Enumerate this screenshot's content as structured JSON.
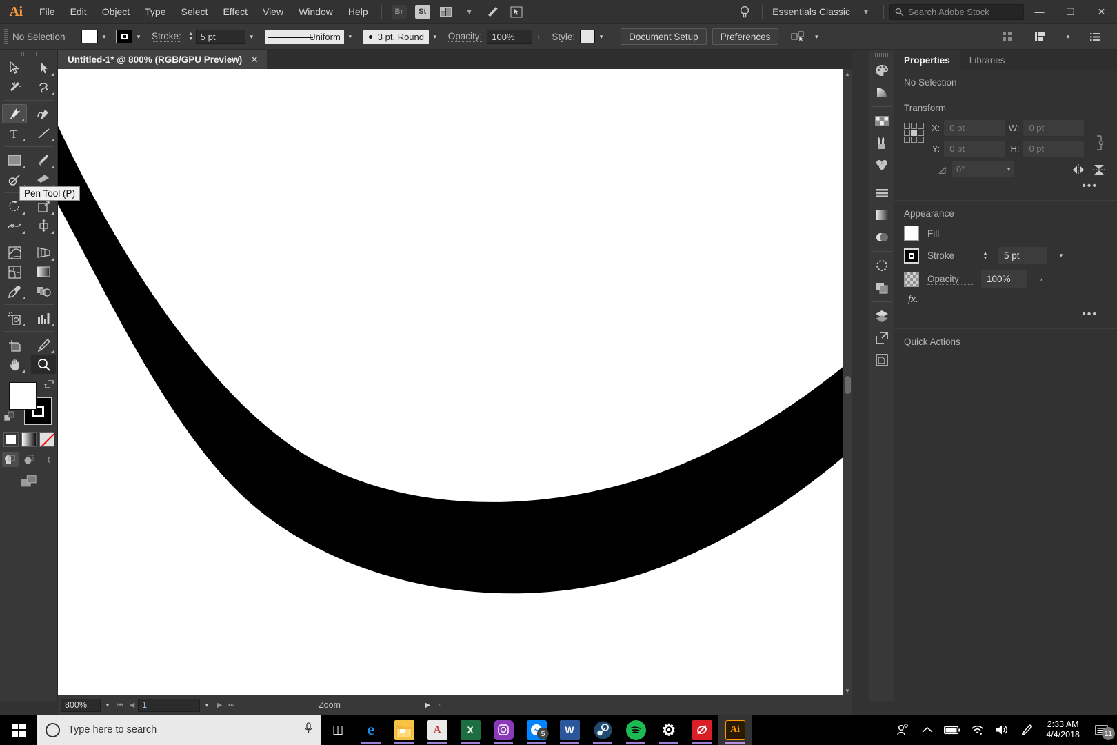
{
  "app": {
    "logo": "Ai",
    "title": "Untitled-1* @ 800% (RGB/GPU Preview)"
  },
  "menubar": {
    "items": [
      "File",
      "Edit",
      "Object",
      "Type",
      "Select",
      "Effect",
      "View",
      "Window",
      "Help"
    ],
    "bridge_label": "Br",
    "stock_label": "St",
    "workspace": "Essentials Classic",
    "search_placeholder": "Search Adobe Stock",
    "window_minimize": "—",
    "window_restore": "❐",
    "window_close": "✕"
  },
  "controlbar": {
    "selection_status": "No Selection",
    "stroke_label": "Stroke:",
    "stroke_weight": "5 pt",
    "profile_label": "Uniform",
    "brush_label": "3 pt. Round",
    "opacity_label": "Opacity:",
    "opacity_value": "100%",
    "style_label": "Style:",
    "document_setup": "Document Setup",
    "preferences": "Preferences"
  },
  "toolbar": {
    "tooltip": "Pen Tool (P)",
    "tools": [
      "selection-tool",
      "direct-selection-tool",
      "magic-wand-tool",
      "lasso-tool",
      "pen-tool",
      "curvature-tool",
      "type-tool",
      "line-segment-tool",
      "rectangle-tool",
      "paintbrush-tool",
      "shaper-tool",
      "eraser-tool",
      "rotate-tool",
      "scale-tool",
      "width-tool",
      "free-transform-tool",
      "shape-builder-tool",
      "perspective-grid-tool",
      "mesh-tool",
      "gradient-tool",
      "eyedropper-tool",
      "blend-tool",
      "symbol-sprayer-tool",
      "column-graph-tool",
      "artboard-tool",
      "slice-tool",
      "hand-tool",
      "zoom-tool"
    ],
    "selected_tool": "pen-tool",
    "active_extra_tool": "zoom-tool"
  },
  "canvas": {
    "artboard_background": "#ffffff",
    "stroke_color": "#000000",
    "shape": "brush-stroke-curve"
  },
  "statusbar": {
    "zoom_level": "800%",
    "page_number": "1",
    "tool_indicator": "Zoom"
  },
  "properties": {
    "tabs": [
      {
        "label": "Properties",
        "active": true
      },
      {
        "label": "Libraries",
        "active": false
      }
    ],
    "no_selection": "No Selection",
    "transform": {
      "title": "Transform",
      "x_label": "X:",
      "x_value": "0 pt",
      "y_label": "Y:",
      "y_value": "0 pt",
      "w_label": "W:",
      "w_value": "0 pt",
      "h_label": "H:",
      "h_value": "0 pt",
      "angle_label": "◿:",
      "angle_value": "0°"
    },
    "appearance": {
      "title": "Appearance",
      "fill_label": "Fill",
      "stroke_label": "Stroke",
      "stroke_value": "5 pt",
      "opacity_label": "Opacity",
      "opacity_value": "100%",
      "fx_label": "fx."
    },
    "quick_actions": {
      "title": "Quick Actions"
    },
    "more_options": "•••"
  },
  "dock_icons": [
    "color-panel-icon",
    "color-guide-icon",
    "swatches-panel-icon",
    "brushes-panel-icon",
    "symbols-panel-icon",
    "align-panel-icon",
    "gradient-panel-icon",
    "transparency-panel-icon",
    "stroke-panel-icon",
    "pathfinder-panel-icon",
    "layers-panel-icon",
    "asset-export-icon",
    "artboards-panel-icon"
  ],
  "taskbar": {
    "search_placeholder": "Type here to search",
    "apps": [
      {
        "name": "task-view",
        "glyph": "❐",
        "color": "transparent",
        "running": false
      },
      {
        "name": "microsoft-edge",
        "glyph": "e",
        "color": "#0a6cbe",
        "running": true
      },
      {
        "name": "file-explorer",
        "glyph": "▭",
        "color": "#f7c04a",
        "running": true
      },
      {
        "name": "adobe-acrobat",
        "glyph": "A",
        "color": "#e8e8e8",
        "running": true
      },
      {
        "name": "microsoft-excel",
        "glyph": "X",
        "color": "#1d6f42",
        "running": true
      },
      {
        "name": "instagram",
        "glyph": "▣",
        "color": "#8a3ab9",
        "running": true
      },
      {
        "name": "facebook-messenger",
        "glyph": "⚡",
        "color": "#0084ff",
        "running": true,
        "badge": "5"
      },
      {
        "name": "microsoft-word",
        "glyph": "W",
        "color": "#2b579a",
        "running": true
      },
      {
        "name": "steam",
        "glyph": "●",
        "color": "#1b2838",
        "running": true
      },
      {
        "name": "spotify",
        "glyph": "♫",
        "color": "#1db954",
        "running": true
      },
      {
        "name": "settings",
        "glyph": "⚙",
        "color": "#2b2b2b",
        "running": true
      },
      {
        "name": "adobe-creative-cloud",
        "glyph": "∞",
        "color": "#da1f26",
        "running": true
      },
      {
        "name": "adobe-illustrator",
        "glyph": "Ai",
        "color": "#2b1a00",
        "running": true,
        "active": true
      }
    ],
    "tray": [
      "people-icon",
      "show-hidden-icons-icon",
      "battery-icon",
      "wifi-icon",
      "volume-icon",
      "pen-icon"
    ],
    "time": "2:33 AM",
    "date": "4/4/2018",
    "notification_count": "11"
  }
}
